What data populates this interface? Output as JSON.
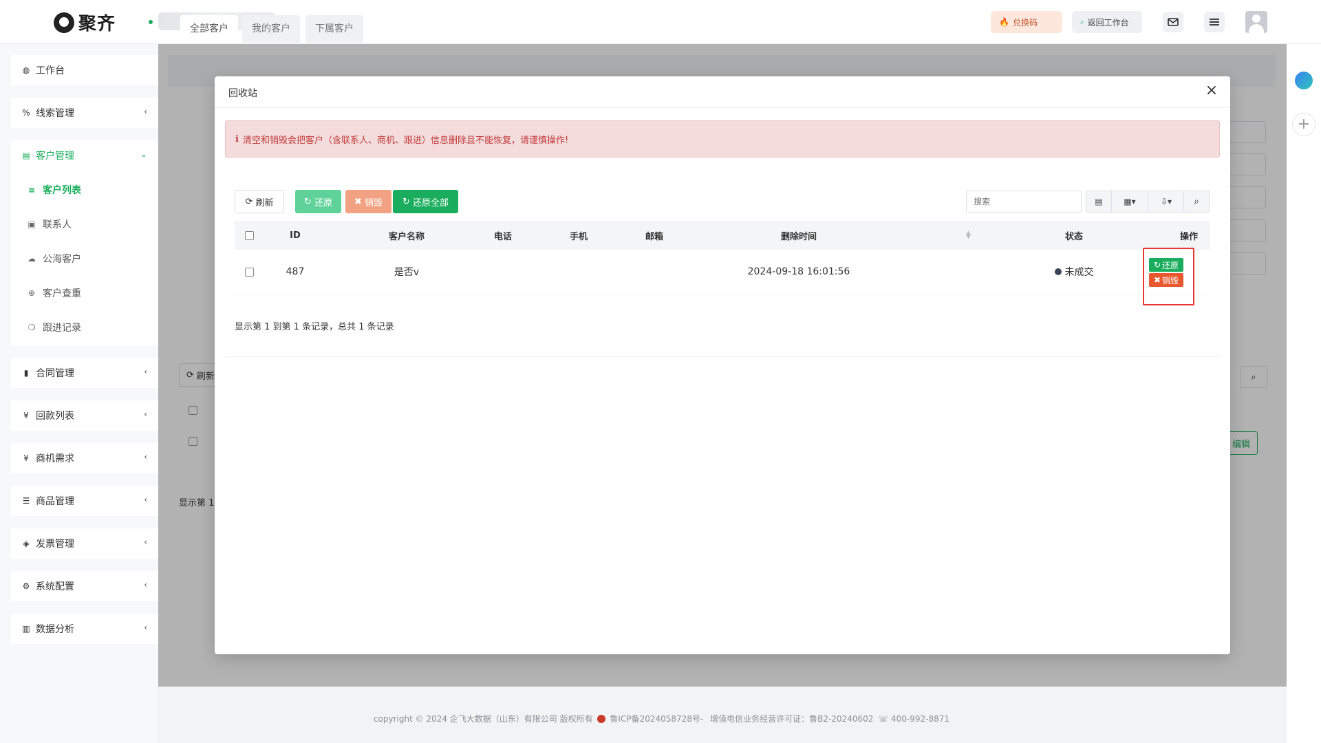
{
  "header": {
    "logo_text": "聚齐",
    "exchange_label": "兑换码",
    "return_label": "返回工作台"
  },
  "sidebar": {
    "items": [
      {
        "label": "工作台",
        "icon": "dashboard-icon"
      },
      {
        "label": "线索管理",
        "icon": "link-icon"
      },
      {
        "label": "客户管理",
        "icon": "id-card-icon"
      },
      {
        "label": "合同管理",
        "icon": "bookmark-icon"
      },
      {
        "label": "回款列表",
        "icon": "yen-icon"
      },
      {
        "label": "商机需求",
        "icon": "yen-icon"
      },
      {
        "label": "商品管理",
        "icon": "list-icon"
      },
      {
        "label": "发票管理",
        "icon": "tag-icon"
      },
      {
        "label": "系统配置",
        "icon": "gears-icon"
      },
      {
        "label": "数据分析",
        "icon": "bar-chart-icon"
      }
    ],
    "sub_items": [
      {
        "label": "客户列表",
        "icon": "list-icon"
      },
      {
        "label": "联系人",
        "icon": "contact-icon"
      },
      {
        "label": "公海客户",
        "icon": "cloud-icon"
      },
      {
        "label": "客户查重",
        "icon": "search-plus-icon"
      },
      {
        "label": "跟进记录",
        "icon": "comments-icon"
      }
    ]
  },
  "background": {
    "tabs": [
      "全部客户",
      "我的客户",
      "下属客户"
    ],
    "refresh_label": "刷新",
    "edit_label": "编辑",
    "footer_text": "显示第 1"
  },
  "modal": {
    "title": "回收站",
    "alert": "清空和销毁会把客户（含联系人、商机、跟进）信息删除且不能恢复，请谨慎操作!",
    "toolbar": {
      "refresh": "刷新",
      "restore": "还原",
      "destroy": "销毁",
      "restore_all": "还原全部",
      "search_placeholder": "搜索"
    },
    "columns": [
      "ID",
      "客户名称",
      "电话",
      "手机",
      "邮箱",
      "删除时间",
      "状态",
      "操作"
    ],
    "rows": [
      {
        "id": "487",
        "name": "是否v",
        "phone": "",
        "mobile": "",
        "email": "",
        "deleted_at": "2024-09-18 16:01:56",
        "status": "未成交",
        "op_restore": "还原",
        "op_destroy": "销毁"
      }
    ],
    "pager": "显示第 1 到第 1 条记录，总共 1 条记录"
  },
  "footer": {
    "copyright": "copyright © 2024 企飞大数据（山东）有限公司 版权所有",
    "icp": "鲁ICP备2024058728号-",
    "license": "增值电信业务经营许可证：鲁B2-20240602",
    "phone": "400-992-8871"
  }
}
